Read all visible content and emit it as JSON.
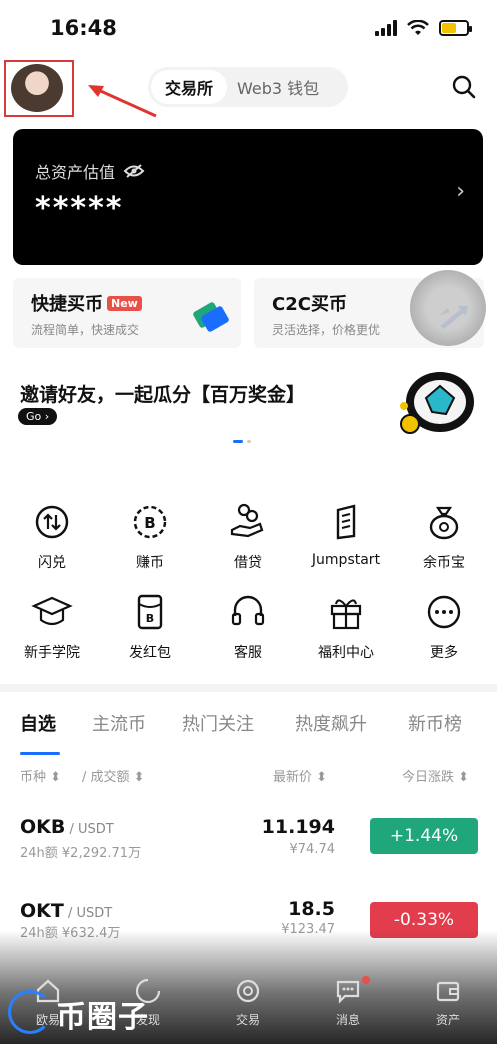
{
  "status_bar": {
    "time": "16:48"
  },
  "header": {
    "tabs": [
      {
        "label": "交易所",
        "active": true
      },
      {
        "label": "Web3 钱包",
        "active": false
      }
    ]
  },
  "asset_card": {
    "label": "总资产估值",
    "value": "*****",
    "chevron": "›"
  },
  "quick_buy": [
    {
      "title": "快捷买币",
      "badge": "New",
      "subtitle": "流程简单，快速成交"
    },
    {
      "title": "C2C买币",
      "subtitle": "灵活选择，价格更优"
    }
  ],
  "banner": {
    "title": "邀请好友，一起瓜分【百万奖金】",
    "button": "Go"
  },
  "services": [
    {
      "label": "闪兑",
      "icon": "swap-icon"
    },
    {
      "label": "赚币",
      "icon": "earn-coin-icon"
    },
    {
      "label": "借贷",
      "icon": "loan-icon"
    },
    {
      "label": "Jumpstart",
      "icon": "jumpstart-icon"
    },
    {
      "label": "余币宝",
      "icon": "savings-bag-icon"
    },
    {
      "label": "新手学院",
      "icon": "graduation-cap-icon"
    },
    {
      "label": "发红包",
      "icon": "red-packet-icon"
    },
    {
      "label": "客服",
      "icon": "headset-icon"
    },
    {
      "label": "福利中心",
      "icon": "gift-icon"
    },
    {
      "label": "更多",
      "icon": "more-icon"
    }
  ],
  "market": {
    "tabs": [
      "自选",
      "主流币",
      "热门关注",
      "热度飙升",
      "新币榜"
    ],
    "active_tab": "自选",
    "columns": {
      "coin": "币种 ⬍",
      "volume": "/ 成交额 ⬍",
      "price": "最新价 ⬍",
      "change": "今日涨跌 ⬍"
    },
    "rows": [
      {
        "symbol": "OKB",
        "pair": " / USDT",
        "volume": "24h额 ¥2,292.71万",
        "price": "11.194",
        "fiat": "¥74.74",
        "change": "+1.44%",
        "direction": "up"
      },
      {
        "symbol": "OKT",
        "pair": " / USDT",
        "volume": "24h额 ¥632.4万",
        "price": "18.5",
        "fiat": "¥123.47",
        "change": "-0.33%",
        "direction": "down"
      }
    ]
  },
  "bottom_nav": [
    {
      "label": "欧易",
      "icon": "home-icon"
    },
    {
      "label": "发现",
      "icon": "discover-icon"
    },
    {
      "label": "交易",
      "icon": "trade-icon"
    },
    {
      "label": "消息",
      "icon": "message-icon"
    },
    {
      "label": "资产",
      "icon": "wallet-icon"
    }
  ],
  "watermark": "币圈子",
  "colors": {
    "up": "#1fa67a",
    "down": "#e23d4c",
    "accent": "#1a6dff"
  }
}
